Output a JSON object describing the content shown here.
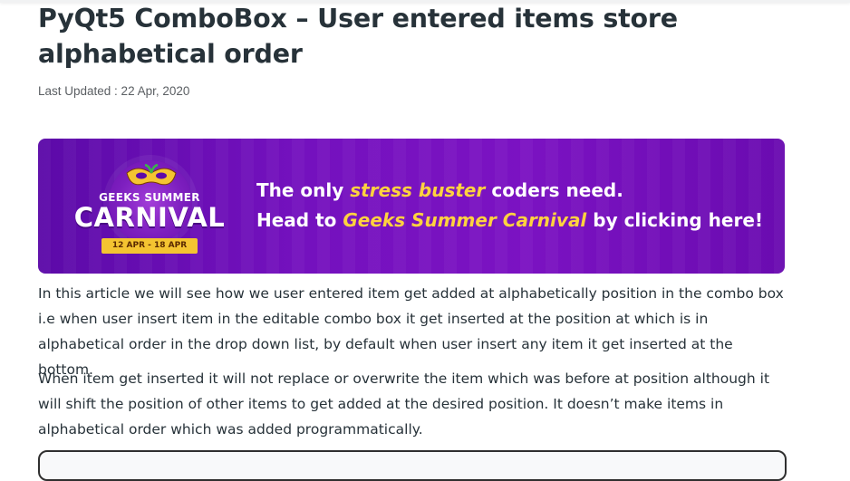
{
  "article": {
    "title": "PyQt5 ComboBox – User entered items store alphabetical order",
    "last_updated": "Last Updated : 22 Apr, 2020",
    "paragraphs": [
      "In this article we will see how we user entered item get added at alphabetically position in the combo box i.e when user insert item in the editable combo box it get inserted at the position at which is in alphabetical order in the drop down list, by default when user insert any item it get inserted at the bottom.",
      "When item get inserted it will not replace or overwrite the item which was before at position although it will shift the position of other items to get added at the desired position. It doesn’t make items in alphabetical order which was added programmatically."
    ]
  },
  "banner": {
    "badge_top": "GEEKS SUMMER",
    "badge_main": "CARNIVAL",
    "badge_dates": "12 APR - 18 APR",
    "line1_prefix": "The only ",
    "line1_highlight": "stress buster",
    "line1_suffix": " coders need.",
    "line2_prefix": "Head to ",
    "line2_highlight": "Geeks Summer Carnival",
    "line2_suffix": " by clicking here!"
  },
  "colors": {
    "banner_purple": "#7411be",
    "highlight_yellow": "#ffd23f",
    "text": "#273239"
  }
}
